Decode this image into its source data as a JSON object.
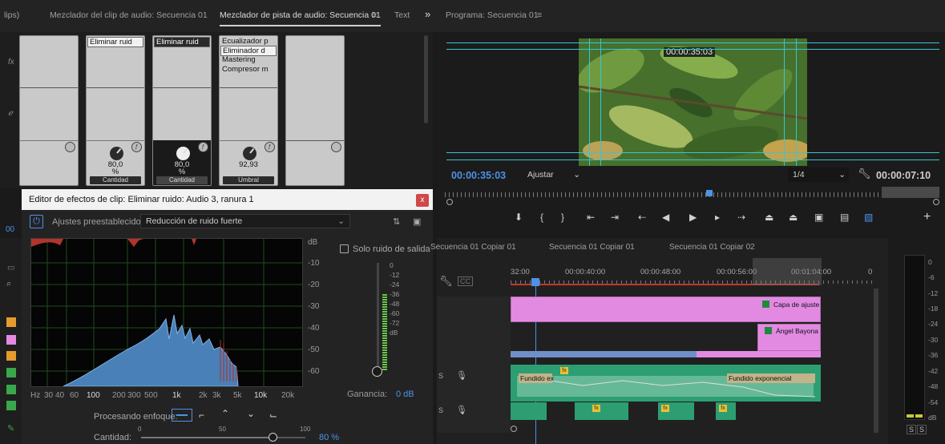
{
  "tabs": {
    "clips_fragment": "lips)",
    "clip_mixer": "Mezclador del clip de audio: Secuencia 01",
    "track_mixer": "Mezclador de pista de audio: Secuencia 01",
    "menu_glyph": "≡",
    "text": "Text",
    "overflow": "»",
    "program": "Programa: Secuencia 01",
    "program_menu": "≡"
  },
  "mixer": {
    "strips": [
      {
        "effects": [
          "",
          "",
          "",
          "",
          "",
          "",
          ""
        ]
      },
      {
        "effects": [
          "Eliminar ruid",
          "",
          "",
          "",
          "",
          "",
          ""
        ],
        "knob_value": "80,0",
        "knob_unit": "%",
        "param": "Cantidad"
      },
      {
        "effects": [
          "Eliminar ruid",
          "",
          "",
          "",
          "",
          "",
          ""
        ],
        "knob_value": "80,0",
        "knob_unit": "%",
        "param": "Cantidad"
      },
      {
        "effects": [
          "Ecualizador p",
          "Eliminador d",
          "Mastering",
          "Compresor m",
          "",
          "",
          ""
        ],
        "knob_value": "92,93",
        "knob_unit": "",
        "param": "Umbral"
      },
      {
        "effects": [
          "",
          "",
          "",
          "",
          "",
          "",
          ""
        ]
      }
    ]
  },
  "dialog": {
    "title": "Editor de efectos de clip: Eliminar ruido: Audio 3, ranura 1",
    "close": "x",
    "presets_label": "Ajustes preestablecidos:",
    "preset_value": "Reducción de ruido fuerte",
    "solo_noise_label": "Solo ruido de salida",
    "db_axis": [
      "dB",
      "-10",
      "-20",
      "-30",
      "-40",
      "-50",
      "-60"
    ],
    "hz_axis": [
      "Hz",
      "30",
      "40",
      "60",
      "100",
      "200",
      "300",
      "500",
      "1k",
      "2k",
      "3k",
      "5k",
      "10k",
      "20k"
    ],
    "meter_scale": [
      "0",
      "-12",
      "-24",
      "-36",
      "-48",
      "-60",
      "-72",
      "dB"
    ],
    "gain_label": "Ganancia:",
    "gain_value": "0 dB",
    "focus_label": "Procesando enfoque:",
    "amount_label": "Cantidad:",
    "amount_ticks": [
      "0",
      "50",
      "100"
    ],
    "amount_value": 0.8,
    "amount_text": "80 %",
    "left_tc_fragment": "00"
  },
  "program": {
    "overlay_timecode": "00:00:35:03",
    "timecode": "00:00:35:03",
    "fit": "Ajustar",
    "resolution": "1/4",
    "duration": "00:00:07:10",
    "plus": "+"
  },
  "timeline": {
    "tabs": [
      "Secuencia 01 Copiar 01",
      "Secuencia 01 Copiar 01",
      "Secuencia 01 Copiar 02"
    ],
    "ruler": [
      "32:00",
      "00:00:40:00",
      "00:00:48:00",
      "00:00:56:00",
      "00:01:04:00",
      "0"
    ],
    "clips": {
      "adjust": "Capa de ajuste",
      "title": "Ángel Bayona",
      "fade_in": "Fundido ex",
      "fade_out": "Fundido exponencial"
    },
    "tracks": [
      {
        "label": "S"
      },
      {
        "label": "S"
      }
    ]
  },
  "meter": {
    "scale": [
      "0",
      "-6",
      "-12",
      "-18",
      "-24",
      "-30",
      "-36",
      "-42",
      "-48",
      "-54",
      "dB"
    ],
    "solo": [
      "S",
      "S"
    ]
  }
}
